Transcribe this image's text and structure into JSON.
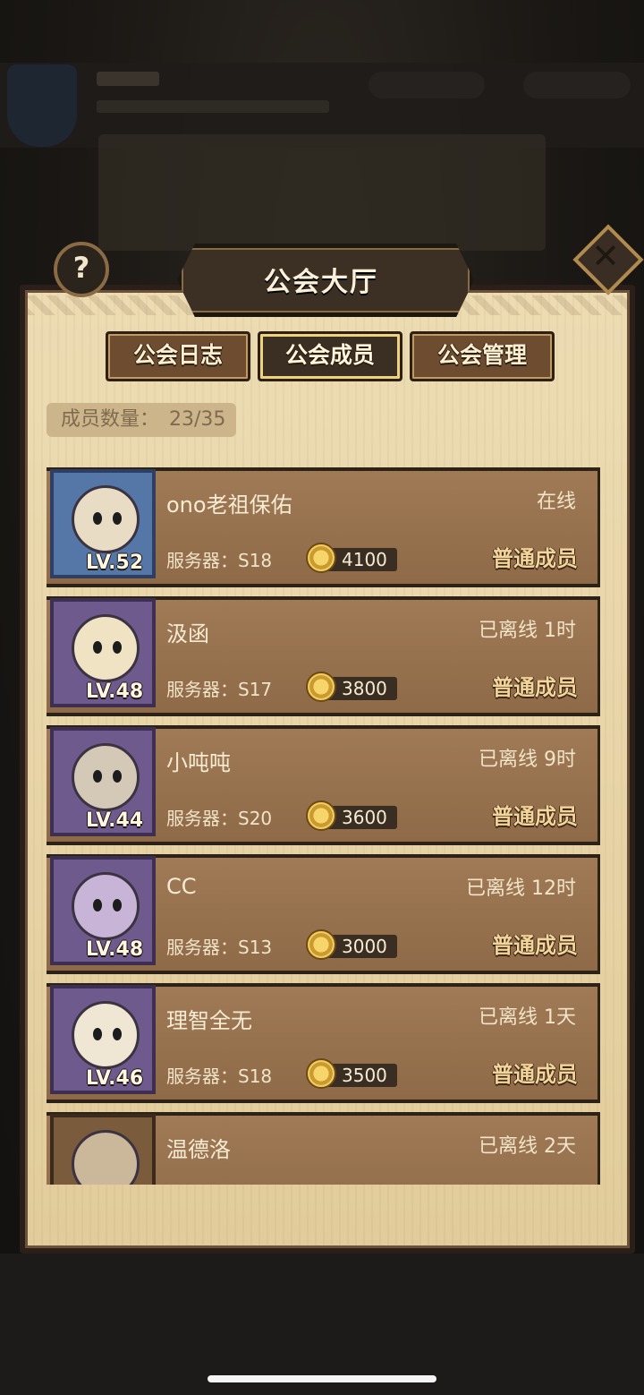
{
  "header": {
    "title": "公会大厅",
    "help_icon": "?",
    "close_icon": "✕"
  },
  "tabs": [
    {
      "label": "公会日志",
      "active": false
    },
    {
      "label": "公会成员",
      "active": true
    },
    {
      "label": "公会管理",
      "active": false
    }
  ],
  "member_count": {
    "label": "成员数量：",
    "value": "23/35"
  },
  "members": [
    {
      "name": "ono老祖保佑",
      "level": "LV.52",
      "status": "在线",
      "server": "服务器：S18",
      "contribution": "4100",
      "role": "普通成员"
    },
    {
      "name": "汲函",
      "level": "LV.48",
      "status": "已离线 1时",
      "server": "服务器：S17",
      "contribution": "3800",
      "role": "普通成员"
    },
    {
      "name": "小吨吨",
      "level": "LV.44",
      "status": "已离线 9时",
      "server": "服务器：S20",
      "contribution": "3600",
      "role": "普通成员"
    },
    {
      "name": "CC",
      "level": "LV.48",
      "status": "已离线 12时",
      "server": "服务器：S13",
      "contribution": "3000",
      "role": "普通成员"
    },
    {
      "name": "理智全无",
      "level": "LV.46",
      "status": "已离线 1天",
      "server": "服务器：S18",
      "contribution": "3500",
      "role": "普通成员"
    },
    {
      "name": "温德洛",
      "level": "",
      "status": "已离线 2天",
      "server": "",
      "contribution": "",
      "role": ""
    }
  ],
  "colors": {
    "panel": "#e7d3a6",
    "card": "#9b7552",
    "accent_gold": "#f3d59a"
  }
}
